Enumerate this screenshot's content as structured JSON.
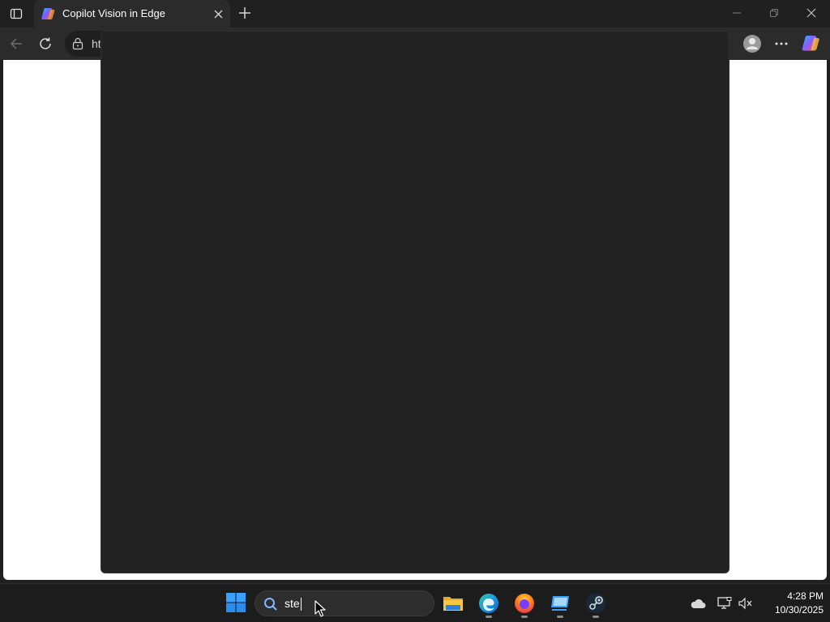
{
  "tab": {
    "title": "Copilot Vision in Edge"
  },
  "address": {
    "url_partial": "ht"
  },
  "taskbar": {
    "search_value": "ste",
    "clock_time": "4:28 PM",
    "clock_date": "10/30/2025"
  },
  "colors": {
    "titlebar": "#202020",
    "toolbar": "#2b2b2b",
    "overlay": "#232323",
    "page": "#ffffff",
    "taskbar": "#1c1c1c"
  },
  "icons": {
    "tab_actions": "tab-actions-icon",
    "favicon": "copilot-icon",
    "close": "close-icon",
    "new_tab": "plus-icon",
    "back": "back-arrow-icon",
    "refresh": "refresh-icon",
    "lock": "lock-icon",
    "profile": "profile-icon",
    "more": "more-icon",
    "copilot": "copilot-icon",
    "start": "windows-icon",
    "search": "search-icon",
    "explorer": "folder-icon",
    "edge": "edge-icon",
    "firefox": "firefox-icon",
    "remote": "remote-desktop-icon",
    "steam": "steam-icon",
    "cloud": "cloud-icon",
    "network": "network-icon",
    "volume": "volume-muted-icon"
  }
}
